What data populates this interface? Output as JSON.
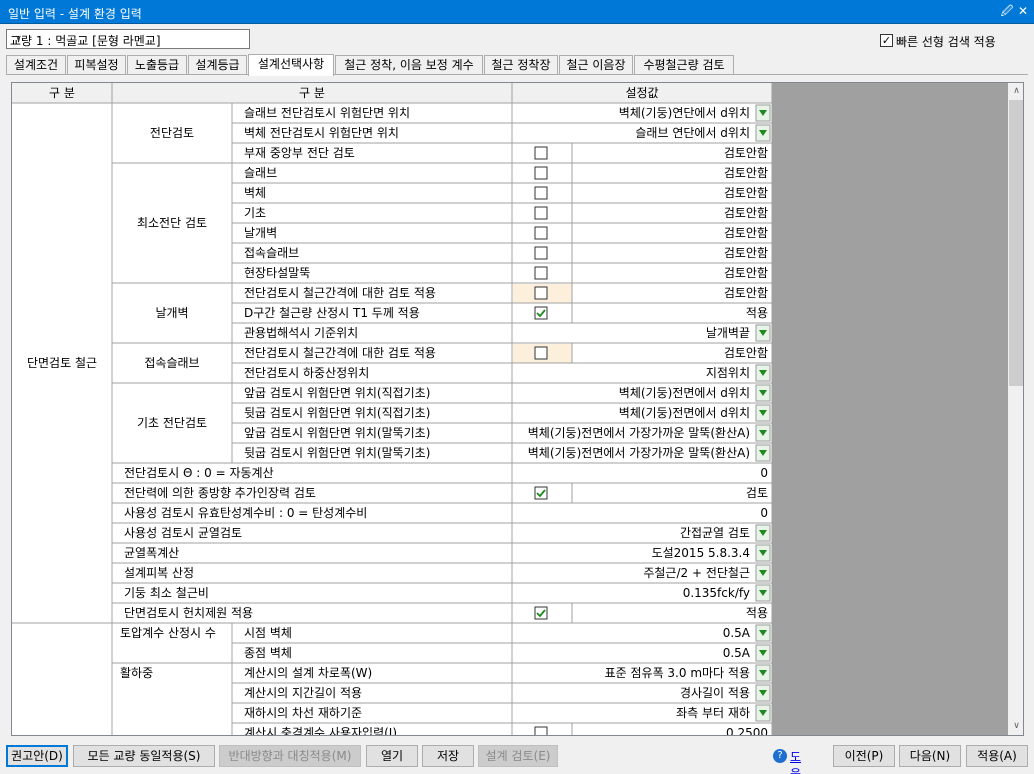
{
  "window": {
    "title": "일반 입력 - 설계 환경 입력",
    "pin_icon": "pin-icon",
    "close_icon": "close-icon"
  },
  "bridge_select": {
    "value": "교량 1 : 먹골교 [문형 라멘교]"
  },
  "fast_search": {
    "label": "빠른 선형 검색 적용",
    "checked": true
  },
  "tabs": [
    {
      "label": "설계조건"
    },
    {
      "label": "피복설정"
    },
    {
      "label": "노출등급"
    },
    {
      "label": "설계등급"
    },
    {
      "label": "설계선택사항",
      "active": true
    },
    {
      "label": "철근 정착, 이음 보정 계수"
    },
    {
      "label": "철근 정착장"
    },
    {
      "label": "철근 이음장"
    },
    {
      "label": "수평철근량 검토"
    }
  ],
  "grid": {
    "headers": {
      "col1": "구  분",
      "col2": "구  분",
      "col3": "설정값"
    },
    "groups": [
      {
        "label": "단면검토 철근"
      },
      {
        "label": ""
      }
    ],
    "subgroups": [
      {
        "label": "전단검토"
      },
      {
        "label": "최소전단 검토"
      },
      {
        "label": "날개벽"
      },
      {
        "label": "접속슬래브"
      },
      {
        "label": "기초 전단검토"
      },
      {
        "label": "토압계수 산정시 수"
      },
      {
        "label": "활하중"
      }
    ],
    "rows": [
      {
        "label": "슬래브 전단검토시 위험단면 위치",
        "value": "벽체(기둥)연단에서 d위치",
        "type": "dropdown"
      },
      {
        "label": "벽체 전단검토시 위험단면 위치",
        "value": "슬래브 연단에서 d위치",
        "type": "dropdown"
      },
      {
        "label": "부재 중앙부 전단 검토",
        "value": "검토안함",
        "type": "checkbox",
        "checked": false
      },
      {
        "label": "슬래브",
        "value": "검토안함",
        "type": "checkbox",
        "checked": false
      },
      {
        "label": "벽체",
        "value": "검토안함",
        "type": "checkbox",
        "checked": false
      },
      {
        "label": "기초",
        "value": "검토안함",
        "type": "checkbox",
        "checked": false
      },
      {
        "label": "날개벽",
        "value": "검토안함",
        "type": "checkbox",
        "checked": false
      },
      {
        "label": "접속슬래브",
        "value": "검토안함",
        "type": "checkbox",
        "checked": false
      },
      {
        "label": "현장타설말뚝",
        "value": "검토안함",
        "type": "checkbox",
        "checked": false
      },
      {
        "label": "전단검토시 철근간격에 대한 검토 적용",
        "value": "검토안함",
        "type": "checkbox",
        "checked": false,
        "highlight": true
      },
      {
        "label": "D구간 철근량 산정시 T1 두께 적용",
        "value": "적용",
        "type": "checkbox",
        "checked": true
      },
      {
        "label": "관용법해석시 기준위치",
        "value": "날개벽끝",
        "type": "dropdown"
      },
      {
        "label": "전단검토시 철근간격에 대한 검토 적용",
        "value": "검토안함",
        "type": "checkbox",
        "checked": false,
        "highlight": true
      },
      {
        "label": "전단검토시 하중산정위치",
        "value": "지점위치",
        "type": "dropdown"
      },
      {
        "label": "앞굽 검토시 위험단면 위치(직접기초)",
        "value": "벽체(기둥)전면에서 d위치",
        "type": "dropdown"
      },
      {
        "label": "뒷굽 검토시 위험단면 위치(직접기초)",
        "value": "벽체(기둥)전면에서 d위치",
        "type": "dropdown"
      },
      {
        "label": "앞굽 검토시 위험단면 위치(말뚝기초)",
        "value": "벽체(기둥)전면에서 가장가까운 말뚝(환산A)",
        "type": "dropdown"
      },
      {
        "label": "뒷굽 검토시 위험단면 위치(말뚝기초)",
        "value": "벽체(기둥)전면에서 가장가까운 말뚝(환산A)",
        "type": "dropdown"
      },
      {
        "label": "전단검토시 Θ : 0 = 자동계산",
        "value": "0",
        "type": "text"
      },
      {
        "label": "전단력에 의한 종방향 추가인장력 검토",
        "value": "검토",
        "type": "checkbox",
        "checked": true
      },
      {
        "label": "사용성 검토시 유효탄성계수비 : 0 = 탄성계수비",
        "value": "0",
        "type": "text"
      },
      {
        "label": "사용성 검토시 균열검토",
        "value": "간접균열 검토",
        "type": "dropdown"
      },
      {
        "label": "균열폭계산",
        "value": "도설2015 5.8.3.4",
        "type": "dropdown"
      },
      {
        "label": "설계피복 산정",
        "value": "주철근/2 + 전단철근",
        "type": "dropdown"
      },
      {
        "label": "기둥 최소 철근비",
        "value": "0.135fck/fy",
        "type": "dropdown"
      },
      {
        "label": "단면검토시 헌치제원 적용",
        "value": "적용",
        "type": "checkbox",
        "checked": true
      },
      {
        "label": "시점 벽체",
        "value": "0.5A",
        "type": "dropdown"
      },
      {
        "label": "종점 벽체",
        "value": "0.5A",
        "type": "dropdown"
      },
      {
        "label": "계산시의 설계 차로폭(W)",
        "value": "표준 점유폭 3.0 m마다 적용",
        "type": "dropdown"
      },
      {
        "label": "계산시의 지간길이 적용",
        "value": "경사길이 적용",
        "type": "dropdown"
      },
      {
        "label": "재하시의 차선 재하기준",
        "value": "좌측 부터 재하",
        "type": "dropdown"
      },
      {
        "label": "계산시 충격계수 사용자입력(I)",
        "value": "0.2500",
        "type": "checkbox",
        "checked": false
      }
    ]
  },
  "scrollbar": {
    "up_icon": "scroll-up-arrow-icon",
    "down_icon": "scroll-down-arrow-icon"
  },
  "buttons": {
    "recommend": "권고안(D)",
    "apply_all": "모든 교량 동일적용(S)",
    "opposite": "반대방향과 대칭적용(M)",
    "open": "열기",
    "save": "저장",
    "design_review": "설계 검토(E)",
    "help": "도움말",
    "prev": "이전(P)",
    "next": "다음(N)",
    "apply": "적용(A)"
  },
  "colors": {
    "titlebar": "#0078d7",
    "highlight_cell": "#fcf0dc",
    "dropdown_green": "#1f8a1f",
    "grid_line": "#a0a0a0"
  }
}
